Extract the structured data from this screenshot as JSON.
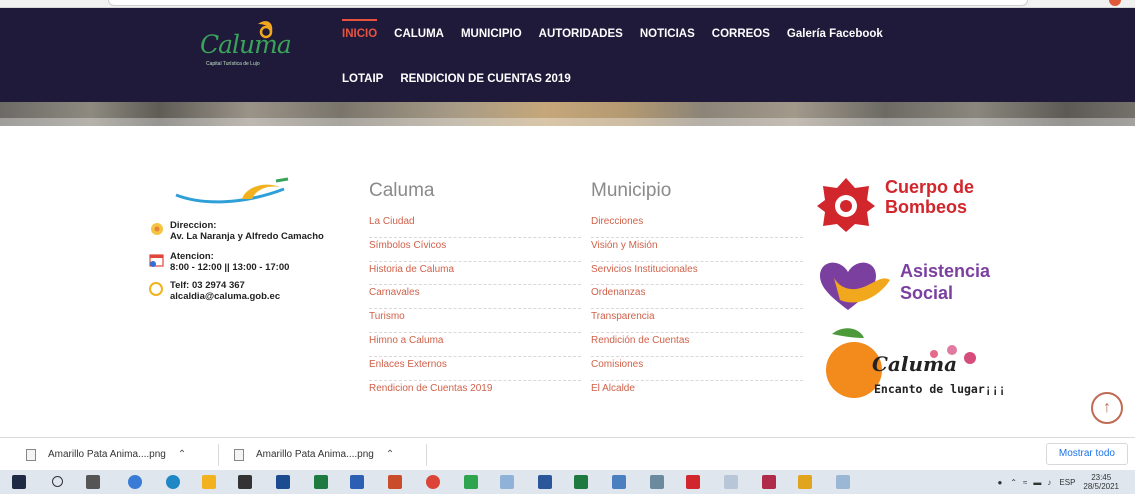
{
  "header": {
    "logo_text": "Caluma",
    "logo_sub": "Capital Turística de Lujo",
    "nav_row1": [
      "INICIO",
      "CALUMA",
      "MUNICIPIO",
      "AUTORIDADES",
      "NOTICIAS",
      "CORREOS",
      "Galería Facebook"
    ],
    "nav_row2": [
      "LOTAIP",
      "RENDICION DE CUENTAS 2019"
    ],
    "active_index": 0,
    "active_color": "#e8533f",
    "bg_color": "#1f1a3a"
  },
  "contact": {
    "direccion_label": "Direccion:",
    "direccion_value": "Av. La Naranja y Alfredo Camacho",
    "atencion_label": "Atencion:",
    "atencion_value": "8:00 - 12:00  || 13:00 - 17:00",
    "telf": "Telf: 03 2974 367",
    "email": "alcaldia@caluma.gob.ec"
  },
  "columns": [
    {
      "title": "Caluma",
      "links": [
        "La Ciudad",
        "Símbolos Cívicos",
        "Historia de Caluma",
        "Carnavales",
        "Turismo",
        "Himno a Caluma",
        "Enlaces Externos",
        "Rendicion de Cuentas 2019"
      ]
    },
    {
      "title": "Municipio",
      "links": [
        "Direcciones",
        "Visión y Misión",
        "Servicios Institucionales",
        "Ordenanzas",
        "Transparencia",
        "Rendición de Cuentas",
        "Comisiones",
        "El Alcalde"
      ]
    }
  ],
  "badges": {
    "bomberos_line1": "Cuerpo de",
    "bomberos_line2": "Bombeos",
    "asistencia_line1": "Asistencia",
    "asistencia_line2": "Social",
    "turismo_brand": "Caluma",
    "turismo_tag": "Encanto de lugar¡¡¡"
  },
  "scroll_top_icon": "arrow-up-icon",
  "downloads": {
    "items": [
      "Amarillo Pata Anima....png",
      "Amarillo Pata Anima....png"
    ],
    "show_all": "Mostrar todo"
  },
  "taskbar": {
    "lang": "ESP",
    "time": "23:45",
    "date": "28/5/2021"
  }
}
